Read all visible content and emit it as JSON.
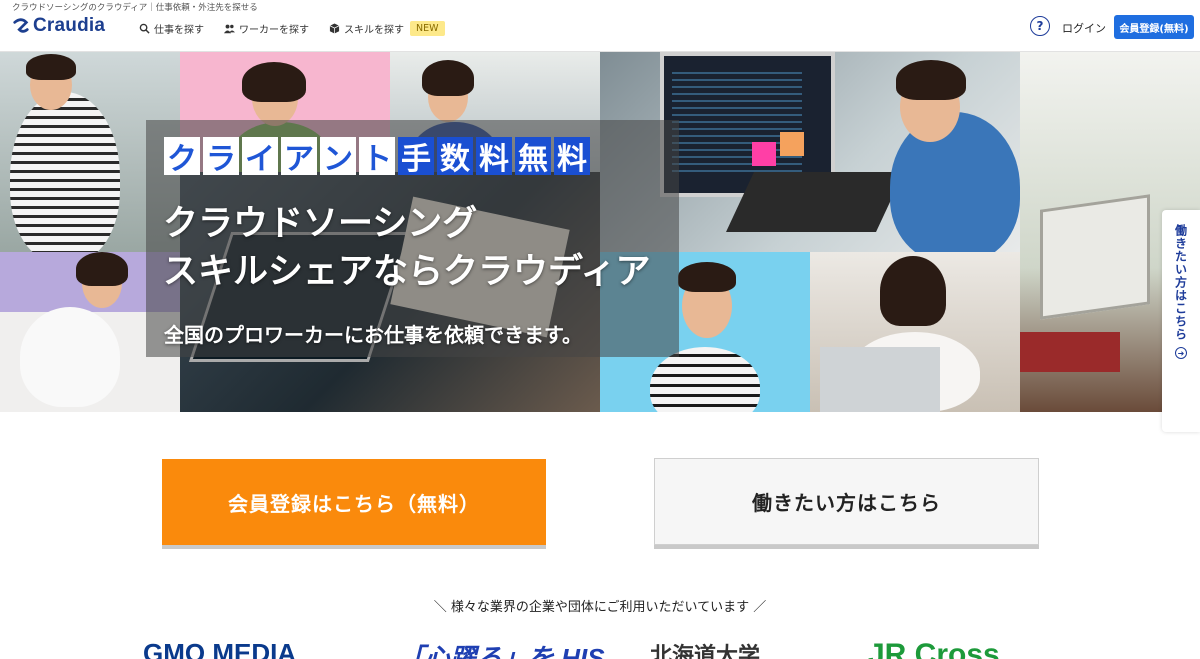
{
  "header": {
    "tagline": "クラウドソーシングのクラウディア｜仕事依頼・外注先を探せる",
    "logo_text": "Craudia",
    "nav": [
      {
        "label": "仕事を探す",
        "icon": "search-icon"
      },
      {
        "label": "ワーカーを探す",
        "icon": "users-icon"
      },
      {
        "label": "スキルを探す",
        "icon": "cube-icon"
      }
    ],
    "new_badge": "NEW",
    "help_label": "?",
    "login_label": "ログイン",
    "register_label": "会員登録(無料)"
  },
  "hero": {
    "tagline_chars": [
      {
        "t": "ク",
        "s": "w"
      },
      {
        "t": "ラ",
        "s": "w"
      },
      {
        "t": "イ",
        "s": "w"
      },
      {
        "t": "ア",
        "s": "w"
      },
      {
        "t": "ン",
        "s": "w"
      },
      {
        "t": "ト",
        "s": "w"
      },
      {
        "t": "手",
        "s": "b"
      },
      {
        "t": "数",
        "s": "b"
      },
      {
        "t": "料",
        "s": "b"
      },
      {
        "t": "無",
        "s": "b"
      },
      {
        "t": "料",
        "s": "b"
      }
    ],
    "title_line1": "クラウドソーシング",
    "title_line2": "スキルシェアならクラウディア",
    "subtitle": "全国のプロワーカーにお仕事を依頼できます。",
    "side_tab_label": "働きたい方はこちら"
  },
  "cta": {
    "register_label": "会員登録はこちら（無料）",
    "worker_label": "働きたい方はこちら"
  },
  "clients": {
    "heading": "＼ 様々な業界の企業や団体にご利用いただいています ／",
    "logos": [
      "GMO MEDIA",
      "「心躍る」を HIS",
      "北海道大学",
      "JR Cross"
    ]
  },
  "colors": {
    "brand_blue": "#1f6ee0",
    "cta_orange": "#fa8a0c",
    "logo_navy": "#1d3f8f"
  }
}
